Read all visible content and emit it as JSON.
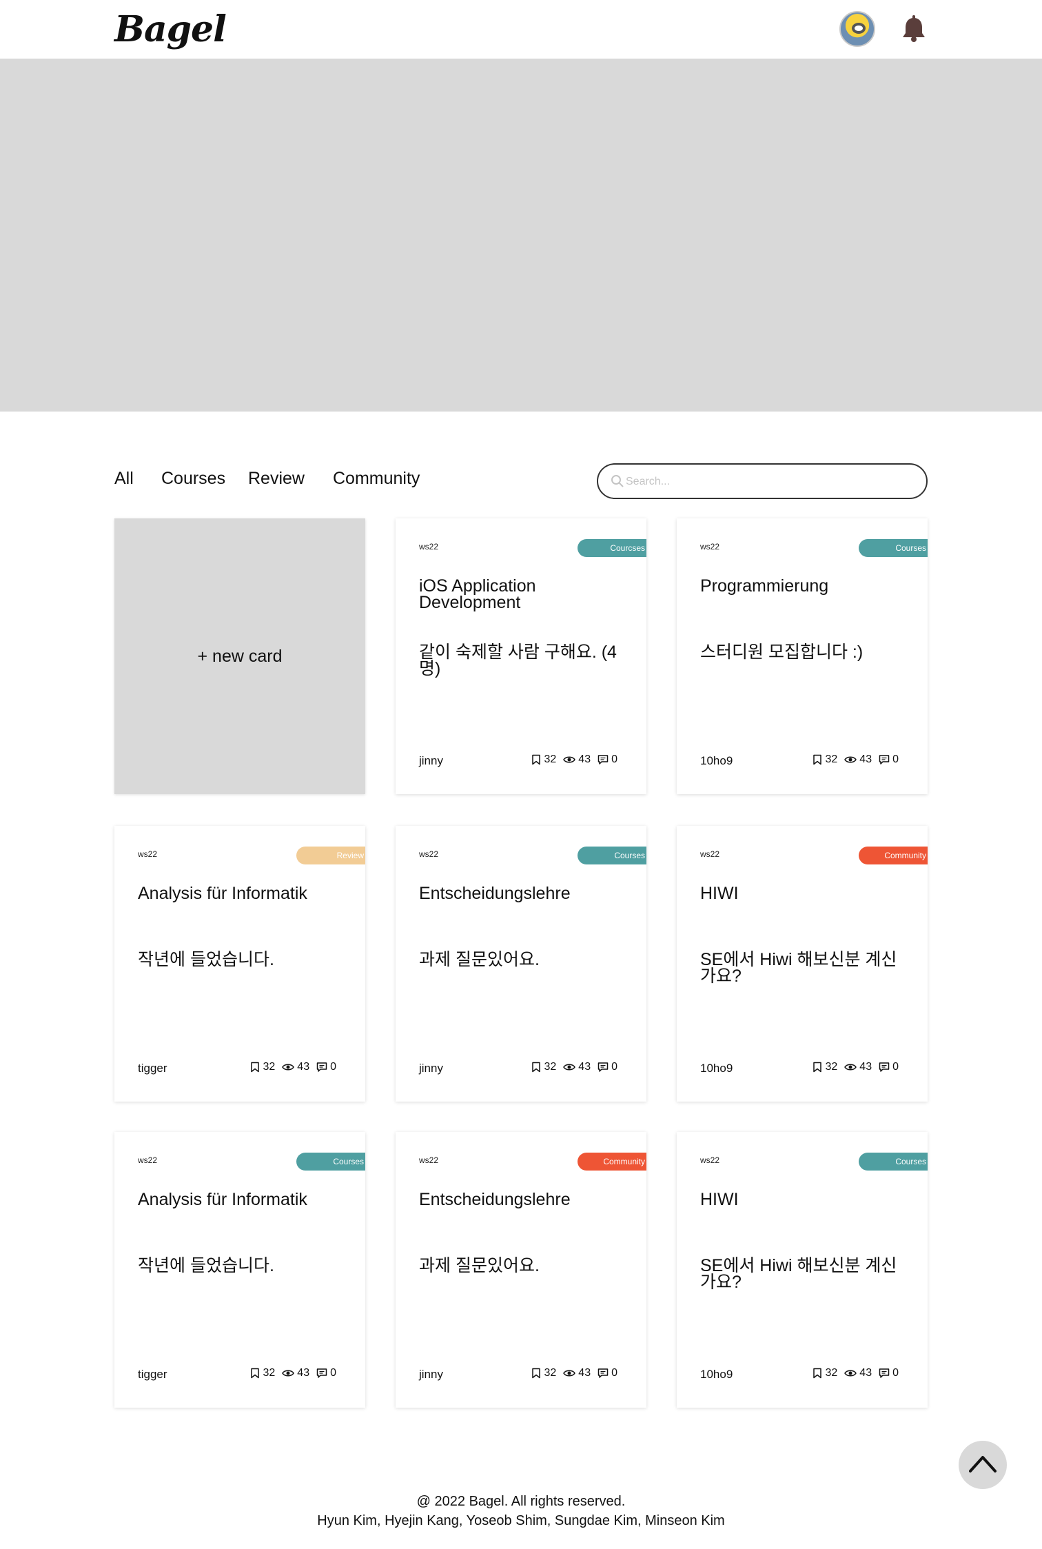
{
  "header": {
    "logo": "Bagel"
  },
  "nav": {
    "tabs": [
      "All",
      "Courses",
      "Review",
      "Community"
    ]
  },
  "search": {
    "placeholder": "Search..."
  },
  "new_card": {
    "label": "+ new card"
  },
  "colors": {
    "courses": "#4f9fa1",
    "review": "#f2cc95",
    "community": "#ee5535"
  },
  "cards": [
    {
      "term": "ws22",
      "tag": "Courcses",
      "tag_type": "courses",
      "title": "iOS Application Development",
      "body": "같이 숙제할 사람 구해요. (4명)",
      "author": "jinny",
      "bookmarks": "32",
      "views": "43",
      "comments": "0"
    },
    {
      "term": "ws22",
      "tag": "Courses",
      "tag_type": "courses",
      "title": "Programmierung",
      "body": "스터디원 모집합니다 :)",
      "author": "10ho9",
      "bookmarks": "32",
      "views": "43",
      "comments": "0"
    },
    {
      "term": "ws22",
      "tag": "Review",
      "tag_type": "review",
      "title": "Analysis für Informatik",
      "body": "작년에 들었습니다.",
      "author": "tigger",
      "bookmarks": "32",
      "views": "43",
      "comments": "0"
    },
    {
      "term": "ws22",
      "tag": "Courses",
      "tag_type": "courses",
      "title": "Entscheidungslehre",
      "body": "과제 질문있어요.",
      "author": "jinny",
      "bookmarks": "32",
      "views": "43",
      "comments": "0"
    },
    {
      "term": "ws22",
      "tag": "Community",
      "tag_type": "community",
      "title": "HIWI",
      "body": "SE에서 Hiwi 해보신분 계신가요?",
      "author": "10ho9",
      "bookmarks": "32",
      "views": "43",
      "comments": "0"
    },
    {
      "term": "ws22",
      "tag": "Courses",
      "tag_type": "courses",
      "title": "Analysis für Informatik",
      "body": "작년에 들었습니다.",
      "author": "tigger",
      "bookmarks": "32",
      "views": "43",
      "comments": "0"
    },
    {
      "term": "ws22",
      "tag": "Community",
      "tag_type": "community",
      "title": "Entscheidungslehre",
      "body": "과제 질문있어요.",
      "author": "jinny",
      "bookmarks": "32",
      "views": "43",
      "comments": "0"
    },
    {
      "term": "ws22",
      "tag": "Courses",
      "tag_type": "courses",
      "title": "HIWI",
      "body": "SE에서 Hiwi 해보신분 계신가요?",
      "author": "10ho9",
      "bookmarks": "32",
      "views": "43",
      "comments": "0"
    }
  ],
  "footer": {
    "copyright": "@ 2022 Bagel. All rights reserved.",
    "authors": "Hyun Kim, Hyejin Kang, Yoseob Shim, Sungdae Kim, Minseon Kim"
  }
}
